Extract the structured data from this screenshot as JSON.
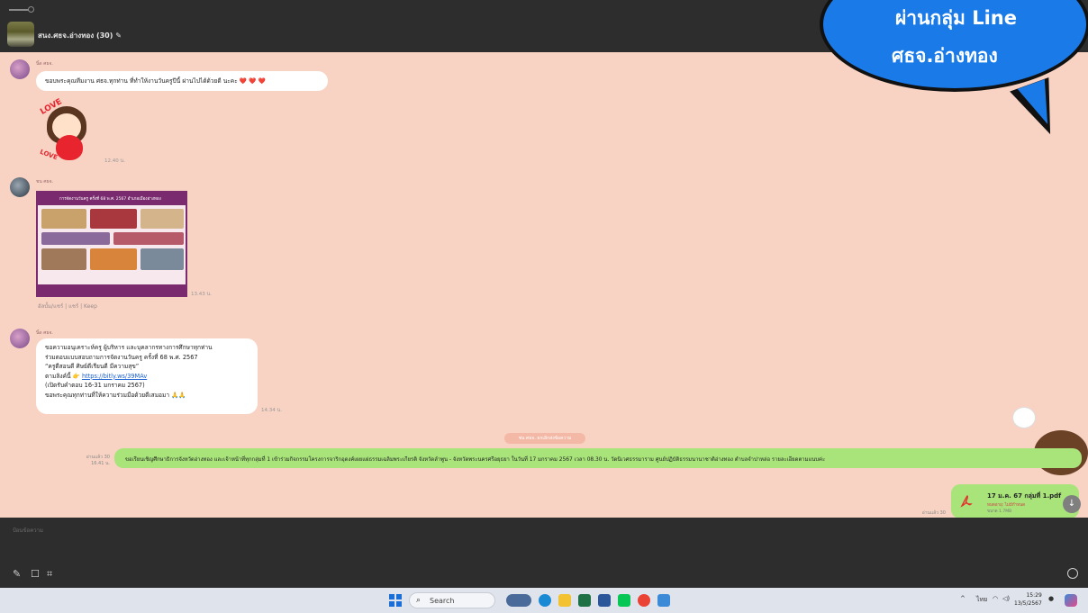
{
  "header": {
    "group_title": "สนง.ศธจ.อ่างทอง (30)",
    "edit_glyph": "✎"
  },
  "overlay_bubble": {
    "line1": "ผ่านกลุ่ม Line",
    "line2": "ศธจ.อ่างทอง"
  },
  "messages": [
    {
      "sender": "นิ้ด ศธจ.",
      "text": "ขอบพระคุณทีมงาน ศธจ.ทุกท่าน ที่ทำให้งานวันครูปีนี้ ผ่านไปได้ด้วยดี นะคะ ❤️ ❤️ ❤️"
    },
    {
      "sticker": "love-sticker",
      "sticker_text_top": "LOVE",
      "sticker_text_bottom": "LOVE",
      "time": "12.40 น."
    },
    {
      "sender": "ชน ศธจ.",
      "poster_title": "การจัดงานวันครู ครั้งที่ 68 พ.ศ. 2567 อำเภอเมืองอ่างทอง",
      "time": "13.43 น.",
      "links": "อัลบั้ม/แชร์ | แชร์ | Keep"
    },
    {
      "sender": "นิ้ด ศธจ.",
      "lines": [
        "ขอความอนุเคราะห์ครู ผู้บริหาร และบุคลากรทางการศึกษาทุกท่าน",
        "ร่วมตอบแบบสอบถามการจัดงานวันครู ครั้งที่ 68 พ.ศ. 2567",
        "“ครูดีสอนดี ศิษย์ดีเรียนดี มีความสุข”",
        "ตามลิงค์นี้  👉",
        "(เปิดรับคำตอบ 16-31 มกราคม 2567)",
        "ขอพระคุณทุกท่านที่ให้ความร่วมมือด้วยดีเสมอมา 🙏🙏"
      ],
      "link": "https://bitly.ws/39MAv",
      "time": "14.34 น."
    }
  ],
  "system_note": "ชน ศธจ. ยกเลิกส่งข้อความ",
  "sent_text": {
    "read": "อ่านแล้ว 30",
    "time": "16.41 น.",
    "text": "ขอเรียนเชิญศึกษาธิการจังหวัดอ่างทอง และเจ้าหน้าที่ทุกกลุ่มที่ 1 เข้าร่วมกิจกรรมโครงการจาริกอุดงค์เผยแผ่ธรรมเฉลิมพระเกียรติ จังหวัดลำพูน - จังหวัดพระนครศรีอยุธยา ในวันที่ 17 มกราคม 2567 เวลา 08.30 น. วัดนิเวศธรรมาราม ศูนย์ปฏิบัติธรรมนานาชาติอ่างทอง ตำบลจำปาหล่อ รายละเอียดตามแนบค่ะ"
  },
  "sent_file": {
    "read": "อ่านแล้ว 30",
    "name": "17 ม.ค. 67 กลุ่มที่ 1.pdf",
    "expiry": "หมดอายุ: ไม่มีกำหนด",
    "size": "ขนาด 1.7MB"
  },
  "input": {
    "placeholder": "ป้อนข้อความ"
  },
  "taskbar": {
    "search_label": "Search",
    "lang": "ไทย",
    "time": "15:29",
    "date": "13/5/2567"
  },
  "colors": {
    "chat_bg": "#f8d3c3",
    "dark_bar": "#2d2d2d",
    "sent_bubble": "#a8e47a",
    "overlay_blue": "#1a7be8",
    "link": "#1a5fd0"
  }
}
